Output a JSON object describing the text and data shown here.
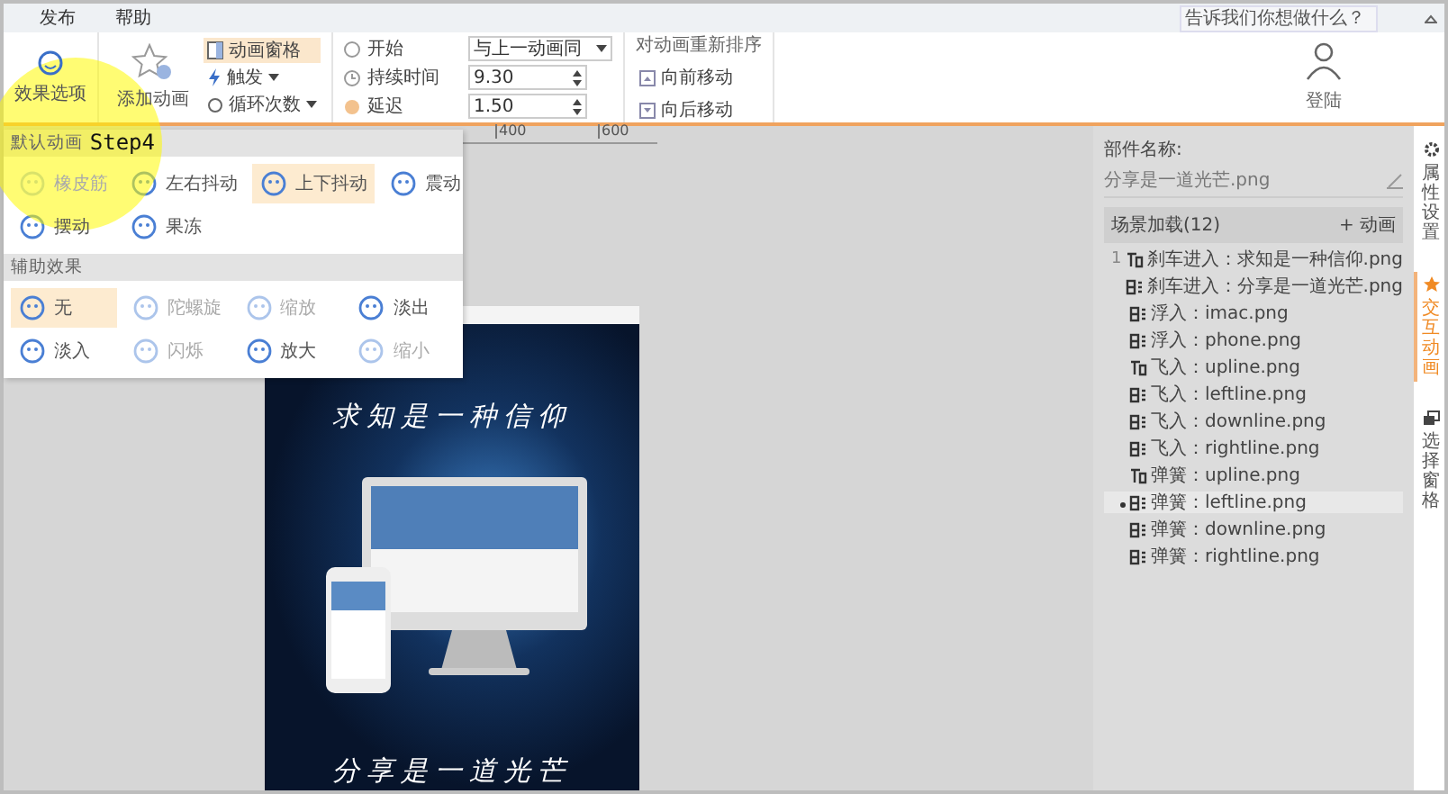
{
  "menu": [
    {
      "label": "发布"
    },
    {
      "label": "帮助"
    }
  ],
  "search": {
    "placeholder": "告诉我们你想做什么？"
  },
  "ribbon": {
    "effect_options": "效果选项",
    "add_animation": "添加动画",
    "pane_toggle": {
      "label": "动画窗格",
      "selected": true
    },
    "trigger": "触发",
    "loop": "循环次数",
    "start": {
      "label": "开始",
      "value": "与上一动画同"
    },
    "duration": {
      "label": "持续时间",
      "value": "9.30"
    },
    "delay": {
      "label": "延迟",
      "value": "1.50"
    },
    "reorder": {
      "title": "对动画重新排序",
      "forward": "向前移动",
      "backward": "向后移动"
    },
    "login": "登陆"
  },
  "ruler": [
    "400",
    "600"
  ],
  "dropdown": {
    "sections": [
      {
        "title": "默认动画",
        "items": [
          {
            "label": "橡皮筋",
            "selected": false,
            "disabled": true
          },
          {
            "label": "左右抖动",
            "selected": false,
            "disabled": false
          },
          {
            "label": "上下抖动",
            "selected": true,
            "disabled": false
          },
          {
            "label": "震动",
            "selected": false,
            "disabled": false
          },
          {
            "label": "摆动",
            "selected": false,
            "disabled": false
          },
          {
            "label": "果冻",
            "selected": false,
            "disabled": false
          }
        ]
      },
      {
        "title": "辅助效果",
        "items": [
          {
            "label": "无",
            "selected": true,
            "disabled": false
          },
          {
            "label": "陀螺旋",
            "selected": false,
            "disabled": true
          },
          {
            "label": "缩放",
            "selected": false,
            "disabled": true
          },
          {
            "label": "淡出",
            "selected": false,
            "disabled": false
          },
          {
            "label": "淡入",
            "selected": false,
            "disabled": false
          },
          {
            "label": "闪烁",
            "selected": false,
            "disabled": true
          },
          {
            "label": "放大",
            "selected": false,
            "disabled": false
          },
          {
            "label": "缩小",
            "selected": false,
            "disabled": true
          }
        ]
      }
    ]
  },
  "step_badge": "Step4",
  "poster": {
    "headline": "求知是一种信仰",
    "tagline": "分享是一道光芒"
  },
  "panel": {
    "name_label": "部件名称:",
    "name_value": "分享是一道光芒.png",
    "list_title": "场景加载(12)",
    "add_button": "+ 动画",
    "items": [
      {
        "number": "1",
        "text": "刹车进入：求知是一种信仰.png",
        "kind": "trigger",
        "selected": false
      },
      {
        "text": "刹车进入：分享是一道光芒.png",
        "kind": "block",
        "selected": false
      },
      {
        "text": "浮入：imac.png",
        "kind": "block",
        "selected": false
      },
      {
        "text": "浮入：phone.png",
        "kind": "block",
        "selected": false
      },
      {
        "text": "飞入：upline.png",
        "kind": "trigger",
        "selected": false
      },
      {
        "text": "飞入：leftline.png",
        "kind": "block",
        "selected": false
      },
      {
        "text": "飞入：downline.png",
        "kind": "block",
        "selected": false
      },
      {
        "text": "飞入：rightline.png",
        "kind": "block",
        "selected": false
      },
      {
        "text": "弹簧：upline.png",
        "kind": "trigger",
        "selected": false
      },
      {
        "text": "弹簧：leftline.png",
        "kind": "block",
        "selected": true
      },
      {
        "text": "弹簧：downline.png",
        "kind": "block",
        "selected": false
      },
      {
        "text": "弹簧：rightline.png",
        "kind": "block",
        "selected": false
      }
    ]
  },
  "side_tabs": [
    {
      "label": "属性设置",
      "kind": "gear",
      "selected": false
    },
    {
      "label": "交互动画",
      "kind": "star",
      "selected": true
    },
    {
      "label": "选择窗格",
      "kind": "windows",
      "selected": false
    }
  ]
}
